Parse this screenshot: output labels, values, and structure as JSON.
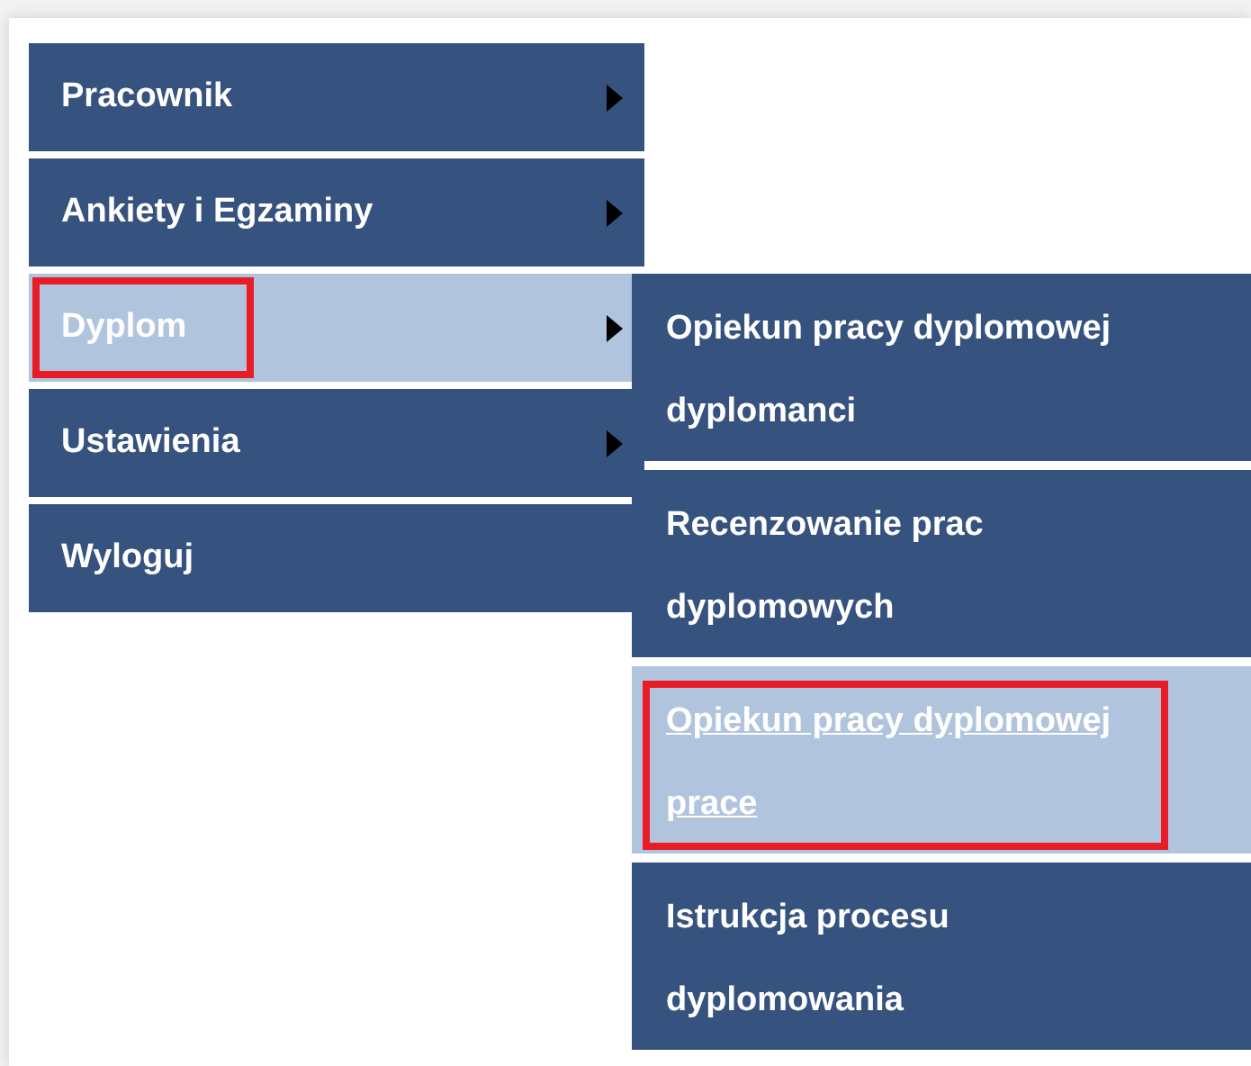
{
  "menu": {
    "items": [
      {
        "label": "Pracownik",
        "has_submenu": true,
        "selected": false,
        "highlighted": false
      },
      {
        "label": "Ankiety i Egzaminy",
        "has_submenu": true,
        "selected": false,
        "highlighted": false
      },
      {
        "label": "Dyplom",
        "has_submenu": true,
        "selected": true,
        "highlighted": true
      },
      {
        "label": "Ustawienia",
        "has_submenu": true,
        "selected": false,
        "highlighted": false
      },
      {
        "label": "Wyloguj",
        "has_submenu": false,
        "selected": false,
        "highlighted": false
      }
    ]
  },
  "submenu": {
    "items": [
      {
        "lines": [
          "Opiekun pracy dyplomowej",
          "dyplomanci"
        ],
        "selected": false,
        "highlighted": false
      },
      {
        "lines": [
          "Recenzowanie prac",
          "dyplomowych"
        ],
        "selected": false,
        "highlighted": false
      },
      {
        "lines": [
          "Opiekun pracy dyplomowej",
          "prace"
        ],
        "selected": true,
        "highlighted": true
      },
      {
        "lines": [
          "Istrukcja procesu",
          "dyplomowania"
        ],
        "selected": false,
        "highlighted": false
      }
    ]
  }
}
